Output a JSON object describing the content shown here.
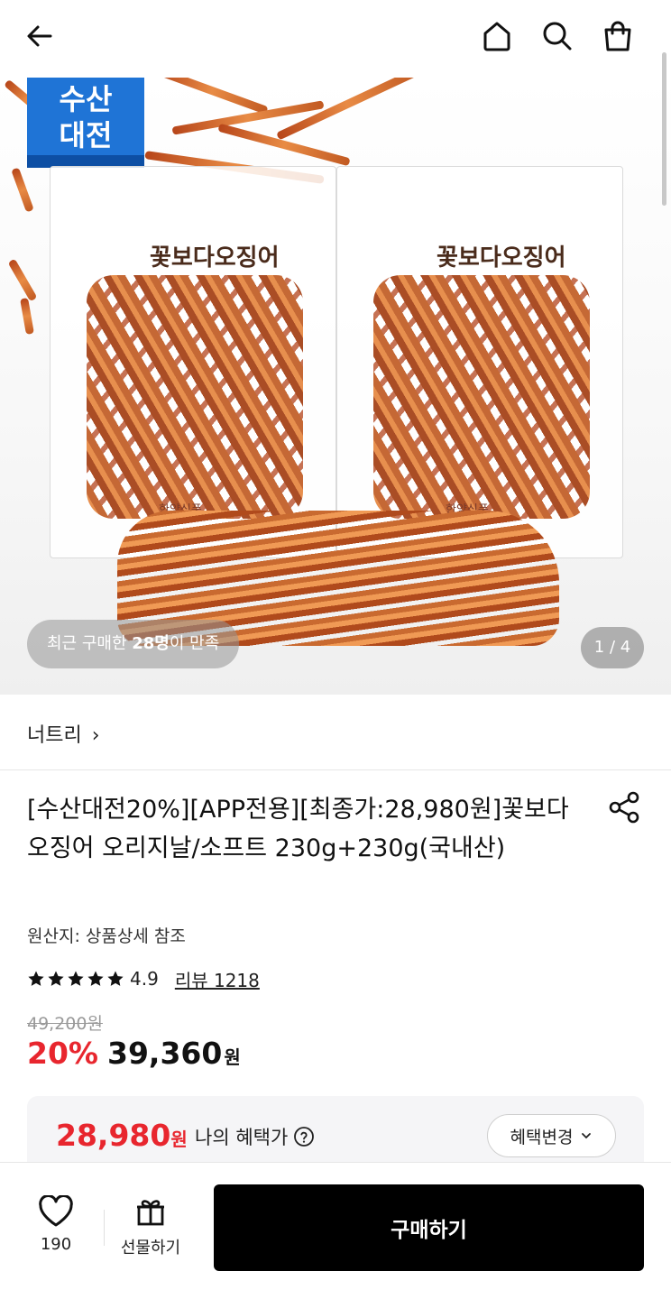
{
  "header": {
    "back_icon": "arrow-left-icon",
    "home_icon": "home-icon",
    "search_icon": "search-icon",
    "cart_icon": "shopping-bag-icon"
  },
  "hero": {
    "badge_line1": "수산",
    "badge_line2": "대전",
    "bag_brand": "꽃보다오징어",
    "bag_maker": "한양식품",
    "satisfaction_prefix": "최근 구매한 ",
    "satisfaction_count": "28명",
    "satisfaction_suffix": "이 만족",
    "pager": "1 / 4"
  },
  "store": {
    "name": "너트리",
    "chevron": "›"
  },
  "product": {
    "title": "[수산대전20%][APP전용][최종가:28,980원]꽃보다오징어 오리지날/소프트 230g+230g(국내산)",
    "origin": "원산지: 상품상세 참조",
    "rating": "4.9",
    "stars": 5,
    "review_link": "리뷰 1218",
    "original_price": "49,200원",
    "discount": "20%",
    "sale_price": "39,360",
    "won": "원"
  },
  "benefit": {
    "price": "28,980",
    "won": "원",
    "label": "나의 혜택가",
    "change_button": "혜택변경"
  },
  "bottom_bar": {
    "like_count": "190",
    "gift_label": "선물하기",
    "buy_label": "구매하기"
  },
  "colors": {
    "accent_red": "#e8262e",
    "badge_blue": "#1f74d6",
    "buy_button": "#000000"
  }
}
